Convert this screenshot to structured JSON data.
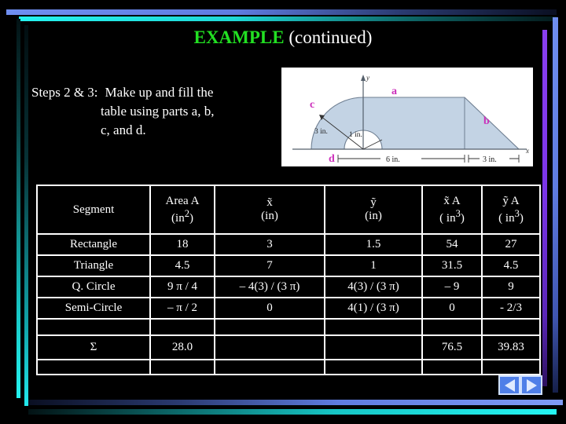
{
  "slide": {
    "title_highlight": "EXAMPLE",
    "title_rest": " (continued)",
    "title_color": "#22e022",
    "background": "#000000"
  },
  "steps": {
    "label": "Steps 2 & 3:",
    "line1": "Make up and fill the",
    "line2": "table using parts a, b,",
    "line3": "c, and d."
  },
  "figure": {
    "axis_x_label": "x",
    "axis_y_label": "y",
    "part_a": "a",
    "part_b": "b",
    "part_c": "c",
    "part_d": "d",
    "dim_radius_c": "3 in.",
    "dim_radius_d": "1 in.",
    "dim_width_rect": "6 in.",
    "dim_width_tri": "3 in.",
    "fill_color": "#c3d3e4",
    "label_color": "#cc2fbb"
  },
  "table": {
    "headers": [
      {
        "line1": "Segment",
        "line2": ""
      },
      {
        "line1": "Area A",
        "line2": "(in2)"
      },
      {
        "line1": "x̃",
        "line2": "(in)"
      },
      {
        "line1": "ỹ",
        "line2": "(in)"
      },
      {
        "line1": "x̃ A",
        "line2": "( in3)"
      },
      {
        "line1": "ỹ A",
        "line2": "( in3)"
      }
    ],
    "rows": [
      {
        "segment": "Rectangle",
        "area": "18",
        "xbar": "3",
        "ybar": "1.5",
        "xa": "54",
        "ya": "27"
      },
      {
        "segment": "Triangle",
        "area": "4.5",
        "xbar": "7",
        "ybar": "1",
        "xa": "31.5",
        "ya": "4.5"
      },
      {
        "segment": "Q. Circle",
        "area": "9 π / 4",
        "xbar": "–  4(3) / (3 π)",
        "ybar": "4(3) / (3 π)",
        "xa": "– 9",
        "ya": "9"
      },
      {
        "segment": "Semi-Circle",
        "area": "– π / 2",
        "xbar": "0",
        "ybar": "4(1) / (3 π)",
        "xa": "0",
        "ya": "- 2/3"
      }
    ],
    "sum": {
      "symbol": "Σ",
      "area": "28.0",
      "xbar": "",
      "ybar": "",
      "xa": "76.5",
      "ya": "39.83"
    }
  },
  "nav": {
    "prev_label": "previous-slide",
    "next_label": "next-slide"
  }
}
